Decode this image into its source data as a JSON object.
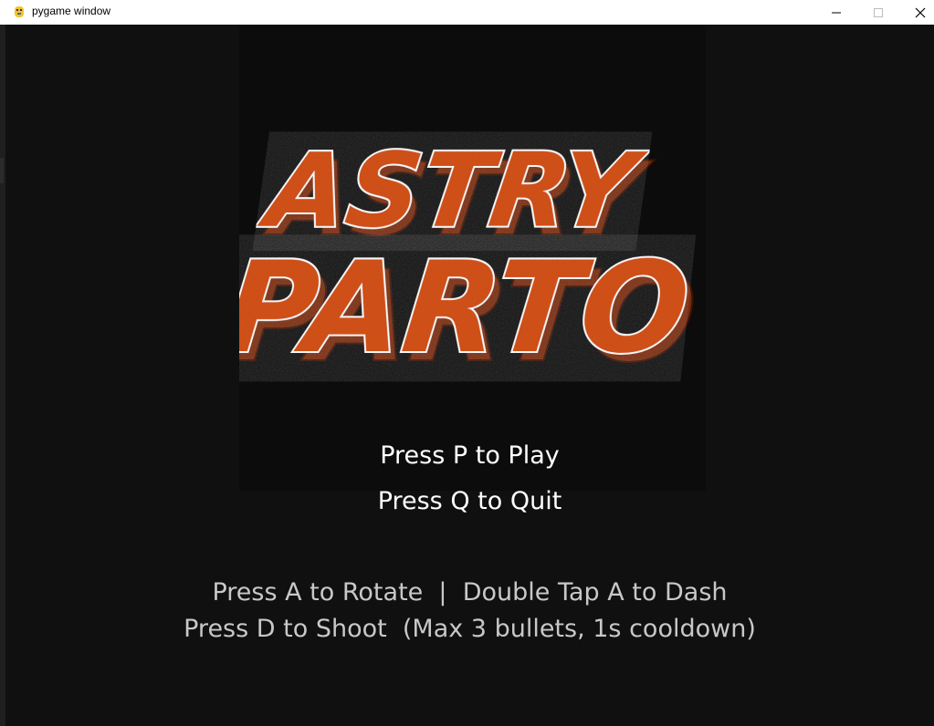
{
  "window": {
    "title": "pygame window",
    "app_icon": "pygame-snake-icon",
    "controls": {
      "minimize_icon": "minimize-icon",
      "maximize_icon": "maximize-icon",
      "close_icon": "close-icon"
    }
  },
  "logo": {
    "line1": "ASTRY",
    "line2": "PARTO"
  },
  "menu": {
    "play": "Press P to Play",
    "quit": "Press Q to Quit"
  },
  "hints": {
    "line1": "Press A to Rotate  |  Double Tap A to Dash",
    "line2": "Press D to Shoot  (Max 3 bullets, 1s cooldown)"
  },
  "colors": {
    "background": "#101010",
    "logo_fill": "#d4521a",
    "logo_shadow": "#7a2a0c",
    "logo_outline": "#ffffff",
    "menu_text": "#ffffff",
    "hint_text": "#c8c8c8"
  }
}
